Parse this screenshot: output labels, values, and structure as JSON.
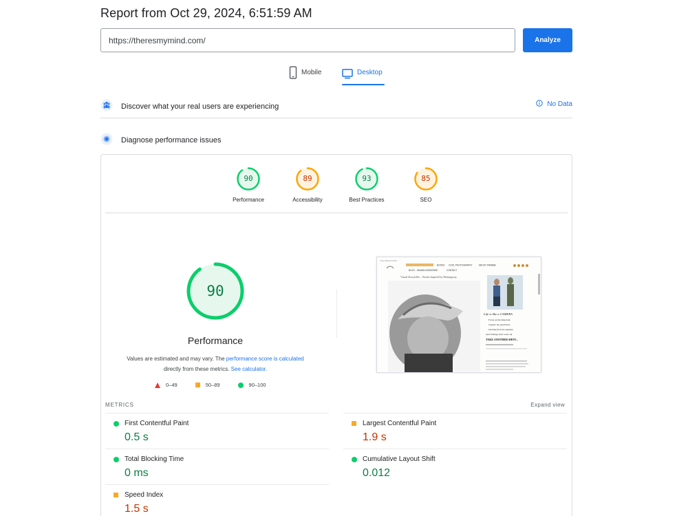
{
  "header": {
    "title": "Report from Oct 29, 2024, 6:51:59 AM",
    "url_value": "https://theresmymind.com/",
    "analyze_label": "Analyze"
  },
  "tabs": [
    {
      "label": "Mobile",
      "icon": "smartphone-icon",
      "selected": false
    },
    {
      "label": "Desktop",
      "icon": "monitor-icon",
      "selected": true
    }
  ],
  "sections": {
    "real_users": {
      "title": "Discover what your real users are experiencing",
      "status": "No Data"
    },
    "diagnose": {
      "title": "Diagnose performance issues"
    }
  },
  "scores": [
    {
      "label": "Performance",
      "score": "90",
      "value": 90,
      "color": "#0cce6b",
      "text_color": "#0c7d43",
      "bg": "#e6f8ee"
    },
    {
      "label": "Accessibility",
      "score": "89",
      "value": 89,
      "color": "#ffa400",
      "text_color": "#c33300",
      "bg": "#fff3e0"
    },
    {
      "label": "Best Practices",
      "score": "93",
      "value": 93,
      "color": "#0cce6b",
      "text_color": "#0c7d43",
      "bg": "#e6f8ee"
    },
    {
      "label": "SEO",
      "score": "85",
      "value": 85,
      "color": "#ffa400",
      "text_color": "#c33300",
      "bg": "#fff3e0"
    }
  ],
  "main_score": {
    "score": "90",
    "value": 90,
    "label": "Performance",
    "note_pre": "Values are estimated and may vary. The ",
    "note_link1": "performance score is calculated",
    "note_mid": "directly from these metrics. ",
    "note_link2": "See calculator."
  },
  "legend": {
    "fail": "0–49",
    "average": "50–89",
    "pass": "90–100"
  },
  "metrics": {
    "header": "METRICS",
    "expand": "Expand view",
    "items": [
      {
        "name": "First Contentful Paint",
        "value": "0.5 s",
        "rating": "pass"
      },
      {
        "name": "Largest Contentful Paint",
        "value": "1.9 s",
        "rating": "average"
      },
      {
        "name": "Total Blocking Time",
        "value": "0 ms",
        "rating": "pass"
      },
      {
        "name": "Cumulative Layout Shift",
        "value": "0.012",
        "rating": "pass"
      },
      {
        "name": "Speed Index",
        "value": "1.5 s",
        "rating": "average"
      }
    ]
  },
  "thumbnail": {
    "nav": [
      "BOOKS",
      "COOL PHOTOGRAPHY",
      "ABOUT KRABBE",
      "BLOG - HUMAN NONSENSE",
      "CONTACT"
    ],
    "tagline": "Visual Storyteller – Books Inspired by Hemingway",
    "poem_title": "Life is like a CAMERA",
    "poem_lines": [
      "Focus on the important",
      "Capture the good times",
      "Develop from the negative",
      "And if things don't work out",
      "TAKE ANOTHER SHOT..."
    ]
  }
}
